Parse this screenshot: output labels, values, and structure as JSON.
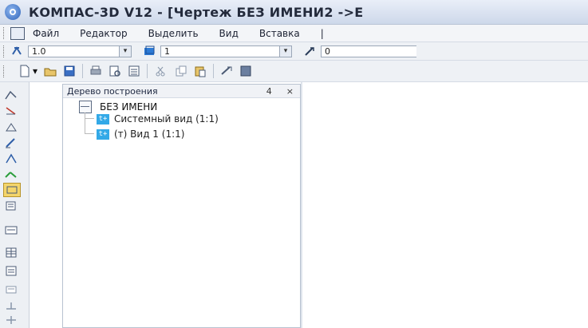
{
  "window": {
    "title": "КОМПАС-3D V12 - [Чертеж БЕЗ ИМЕНИ2 ->E"
  },
  "menu": {
    "items": [
      "Файл",
      "Редактор",
      "Выделить",
      "Вид",
      "Вставка",
      "|"
    ]
  },
  "toolbar1": {
    "scale_value": "1.0",
    "layer_value": "1",
    "style_value": "0"
  },
  "tree_panel": {
    "title": "Дерево построения",
    "pin_label": "4",
    "close_label": "×",
    "root_label": "БЕЗ ИМЕНИ",
    "children": [
      {
        "icon_text": "t+",
        "label": "Системный вид (1:1)"
      },
      {
        "icon_text": "t+",
        "label": "(т) Вид 1 (1:1)"
      }
    ]
  },
  "colors": {
    "node_icon": "#33a9e7",
    "titlebar_top": "#e9eef8",
    "titlebar_bottom": "#cdd8ea"
  },
  "icons": {
    "titlebar": "kompas-logo-icon",
    "new": "new-document-icon",
    "open": "open-folder-icon",
    "save": "save-icon",
    "print": "print-icon",
    "preview": "print-preview-icon",
    "properties": "properties-icon",
    "cut": "cut-icon",
    "copy": "copy-icon",
    "paste": "paste-icon",
    "format": "format-icon",
    "grid": "grid-icon"
  }
}
